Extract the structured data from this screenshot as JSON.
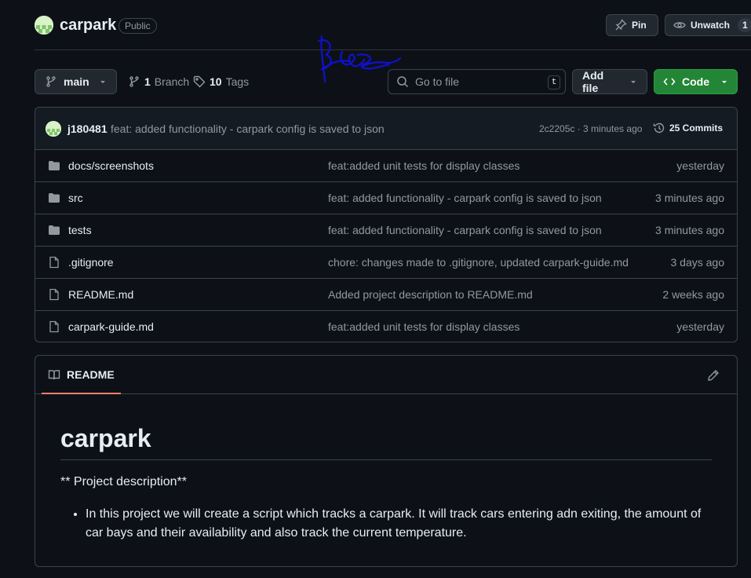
{
  "repo": {
    "name": "carpark",
    "visibility": "Public",
    "pin_label": "Pin",
    "watch_label": "Unwatch",
    "watch_count": "1"
  },
  "toolbar": {
    "branch": "main",
    "branch_count": "1",
    "branch_word": "Branch",
    "tag_count": "10",
    "tag_word": "Tags",
    "search_placeholder": "Go to file",
    "search_shortcut": "t",
    "add_file_label": "Add file",
    "code_label": "Code"
  },
  "latest_commit": {
    "author": "j180481",
    "message": "feat: added functionality - carpark config is saved to json",
    "sha_time": "2c2205c · 3 minutes ago",
    "commits_label": "25 Commits"
  },
  "files": [
    {
      "name": "docs/screenshots",
      "type": "folder",
      "commit": "feat:added unit tests for display classes",
      "date": "yesterday"
    },
    {
      "name": "src",
      "type": "folder",
      "commit": "feat: added functionality - carpark config is saved to json",
      "date": "3 minutes ago"
    },
    {
      "name": "tests",
      "type": "folder",
      "commit": "feat: added functionality - carpark config is saved to json",
      "date": "3 minutes ago"
    },
    {
      "name": ".gitignore",
      "type": "file",
      "commit": "chore: changes made to .gitignore, updated carpark-guide.md",
      "date": "3 days ago"
    },
    {
      "name": "README.md",
      "type": "file",
      "commit": "Added project description to README.md",
      "date": "2 weeks ago"
    },
    {
      "name": "carpark-guide.md",
      "type": "file",
      "commit": "feat:added unit tests for display classes",
      "date": "yesterday"
    }
  ],
  "readme": {
    "tab_label": "README",
    "title": "carpark",
    "description": "** Project description**",
    "bullets": [
      "In this project we will create a script which tracks a carpark. It will track cars entering adn exiting, the amount of car bays and their availability and also track the current temperature."
    ]
  },
  "colors": {
    "background": "#0d1117",
    "border": "#3d444d",
    "code_button": "#238636",
    "tab_underline": "#f78166",
    "signature_ink": "#1010d0"
  },
  "icons": [
    "repo-avatar-icon",
    "pin-icon",
    "eye-icon",
    "branch-icon",
    "tag-icon",
    "search-icon",
    "code-icon",
    "history-icon",
    "folder-icon",
    "file-icon",
    "book-icon",
    "pencil-icon"
  ]
}
